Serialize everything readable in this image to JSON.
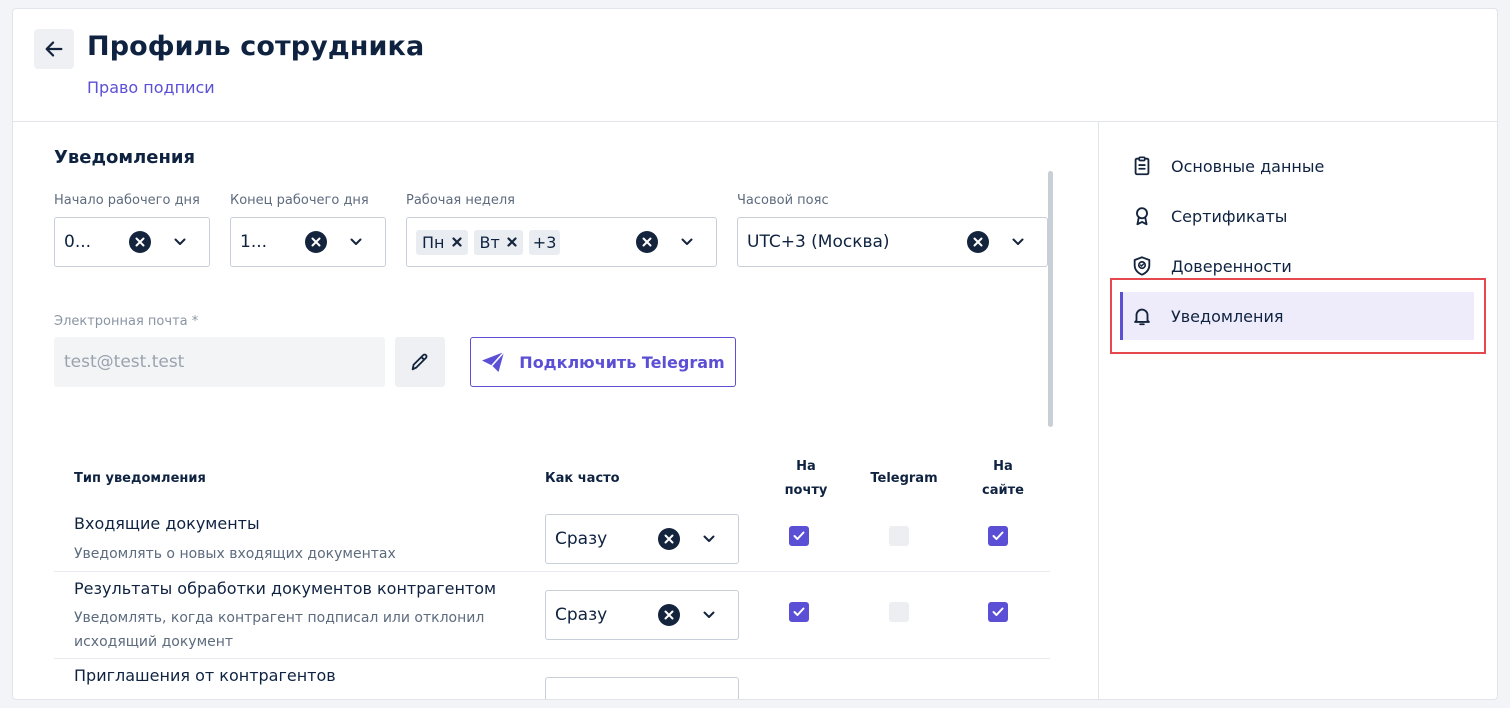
{
  "header": {
    "title": "Профиль сотрудника",
    "subtitle_link": "Право подписи"
  },
  "notifications_section": {
    "title": "Уведомления",
    "work_start": {
      "label": "Начало рабочего дня",
      "value": "0..."
    },
    "work_end": {
      "label": "Конец рабочего дня",
      "value": "1..."
    },
    "work_week": {
      "label": "Рабочая неделя",
      "chips": [
        "Пн",
        "Вт"
      ],
      "more": "+3"
    },
    "timezone": {
      "label": "Часовой пояс",
      "value": "UTC+3 (Москва)"
    },
    "email": {
      "label": "Электронная почта *",
      "placeholder": "test@test.test"
    },
    "telegram_button": "Подключить Telegram"
  },
  "table": {
    "headers": {
      "type": "Тип уведомления",
      "frequency": "Как часто",
      "email_line1": "На",
      "email_line2": "почту",
      "telegram": "Telegram",
      "site_line1": "На",
      "site_line2": "сайте"
    },
    "rows": [
      {
        "title": "Входящие документы",
        "description": "Уведомлять о новых входящих документах",
        "frequency": "Сразу",
        "email": true,
        "telegram": false,
        "site": true
      },
      {
        "title": "Результаты обработки документов контрагентом",
        "description": "Уведомлять, когда контрагент подписал или отклонил исходящий документ",
        "frequency": "Сразу",
        "email": true,
        "telegram": false,
        "site": true
      },
      {
        "title": "Приглашения от контрагентов"
      }
    ]
  },
  "sidebar": {
    "items": [
      {
        "label": "Основные данные",
        "icon": "clipboard-icon"
      },
      {
        "label": "Сертификаты",
        "icon": "award-icon"
      },
      {
        "label": "Доверенности",
        "icon": "shield-check-icon"
      },
      {
        "label": "Уведомления",
        "icon": "bell-icon",
        "active": true
      }
    ]
  },
  "colors": {
    "accent": "#5b4fd6",
    "text": "#0f2341",
    "highlight": "#e5484d"
  }
}
